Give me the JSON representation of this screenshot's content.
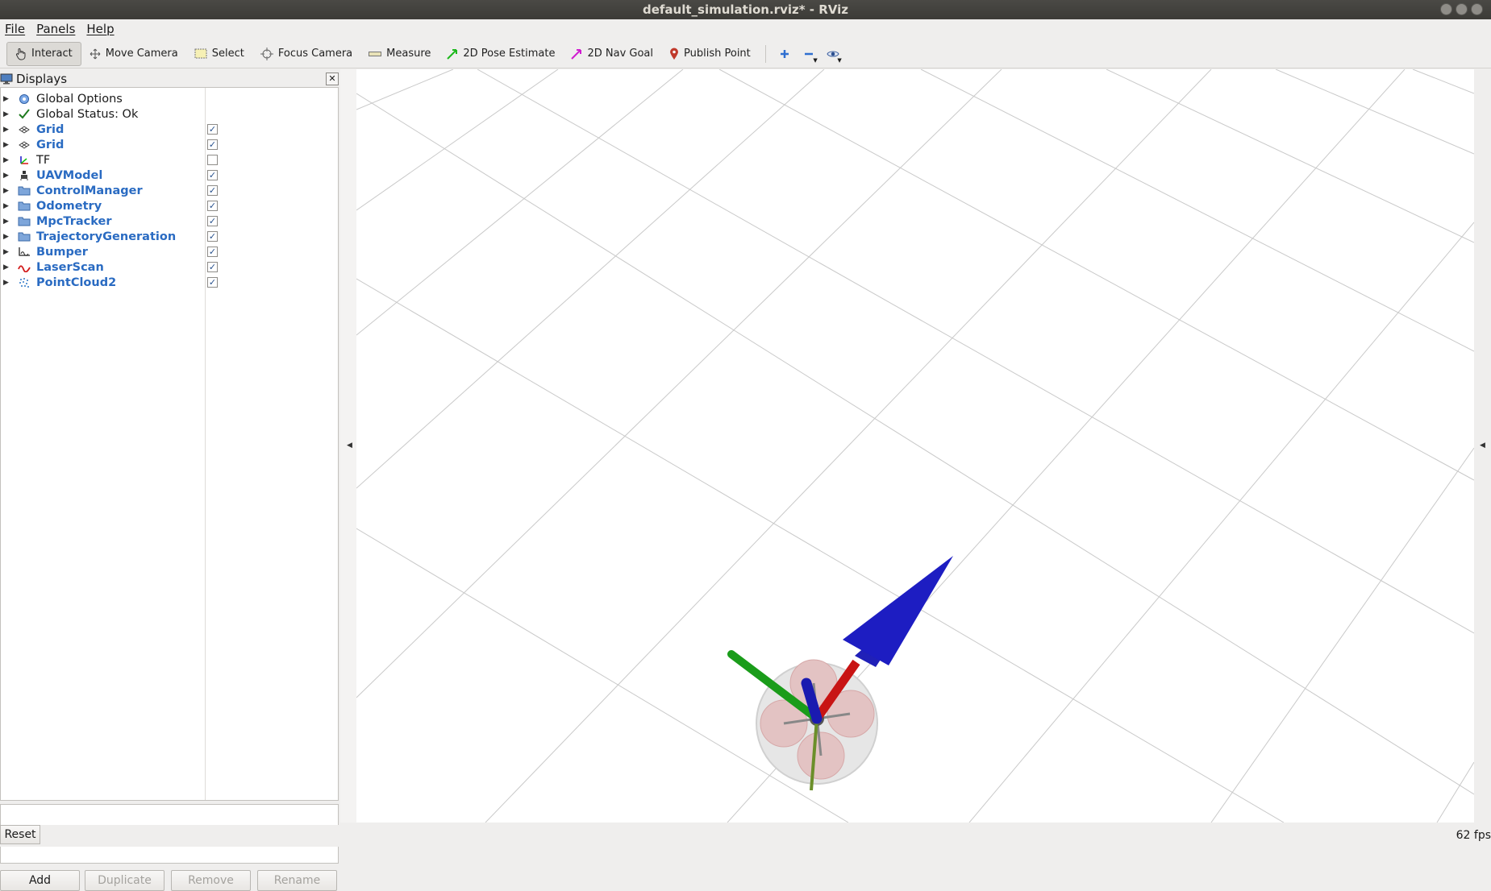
{
  "window": {
    "title": "default_simulation.rviz* - RViz"
  },
  "menu": {
    "file": "File",
    "panels": "Panels",
    "help": "Help"
  },
  "toolbar": {
    "interact": "Interact",
    "move_camera": "Move Camera",
    "select": "Select",
    "focus_camera": "Focus Camera",
    "measure": "Measure",
    "pose_estimate": "2D Pose Estimate",
    "nav_goal": "2D Nav Goal",
    "publish_point": "Publish Point"
  },
  "displays_panel": {
    "title": "Displays",
    "items": [
      {
        "label": "Global Options",
        "icon": "gear-icon",
        "checked": null,
        "highlight": false
      },
      {
        "label": "Global Status: Ok",
        "icon": "checkmark-icon",
        "checked": null,
        "highlight": false
      },
      {
        "label": "Grid",
        "icon": "grid-icon",
        "checked": true,
        "highlight": true
      },
      {
        "label": "Grid",
        "icon": "grid-icon",
        "checked": true,
        "highlight": true
      },
      {
        "label": "TF",
        "icon": "axes-icon",
        "checked": false,
        "highlight": false
      },
      {
        "label": "UAVModel",
        "icon": "robot-model-icon",
        "checked": true,
        "highlight": true
      },
      {
        "label": "ControlManager",
        "icon": "folder-icon",
        "checked": true,
        "highlight": true
      },
      {
        "label": "Odometry",
        "icon": "folder-icon",
        "checked": true,
        "highlight": true
      },
      {
        "label": "MpcTracker",
        "icon": "folder-icon",
        "checked": true,
        "highlight": true
      },
      {
        "label": "TrajectoryGeneration",
        "icon": "folder-icon",
        "checked": true,
        "highlight": true
      },
      {
        "label": "Bumper",
        "icon": "bumper-icon",
        "checked": true,
        "highlight": true
      },
      {
        "label": "LaserScan",
        "icon": "laser-scan-icon",
        "checked": true,
        "highlight": true
      },
      {
        "label": "PointCloud2",
        "icon": "point-cloud-icon",
        "checked": true,
        "highlight": true
      }
    ],
    "buttons": {
      "add": "Add",
      "duplicate": "Duplicate",
      "remove": "Remove",
      "rename": "Rename"
    }
  },
  "status": {
    "reset": "Reset",
    "fps": "62 fps"
  },
  "colors": {
    "link": "#2a6bc2",
    "axis_x": "#d81414",
    "axis_y": "#14c014",
    "axis_z": "#1414c8"
  }
}
